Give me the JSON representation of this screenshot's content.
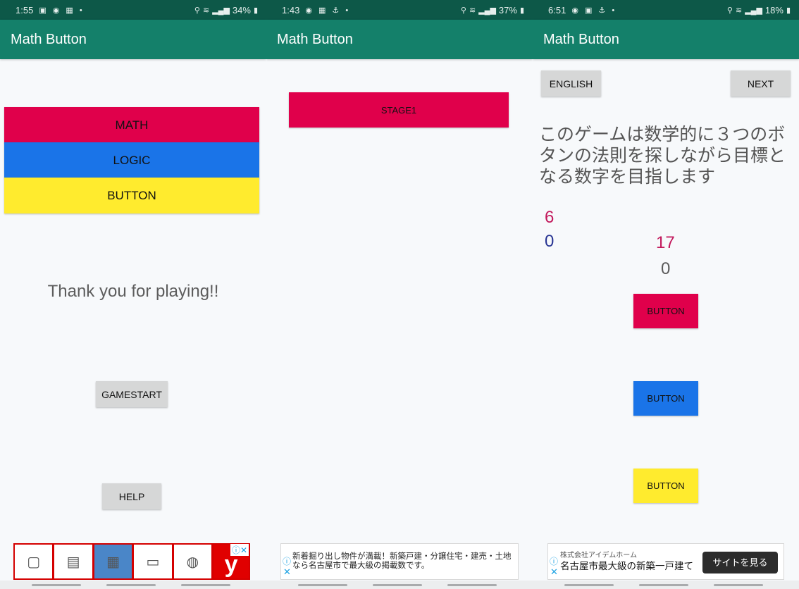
{
  "screens": [
    {
      "status": {
        "time": "1:55",
        "battery": "34%"
      },
      "app_title": "Math Button",
      "banner": [
        "MATH",
        "LOGIC",
        "BUTTON"
      ],
      "message": "Thank you for playing!!",
      "gamestart": "GAMESTART",
      "help": "HELP"
    },
    {
      "status": {
        "time": "1:43",
        "battery": "37%"
      },
      "app_title": "Math Button",
      "stage": "STAGE1",
      "ad_text": "新着掘り出し物件が満載！新築戸建・分譲住宅・建売・土地なら名古屋市で最大級の掲載数です。"
    },
    {
      "status": {
        "time": "6:51",
        "battery": "18%"
      },
      "app_title": "Math Button",
      "english": "ENGLISH",
      "next": "NEXT",
      "description": "このゲームは数学的に３つのボタンの法則を探しながら目標となる数字を目指します",
      "value_red": "6",
      "value_navy": "0",
      "target": "17",
      "current": "0",
      "button_red": "BUTTON",
      "button_blue": "BUTTON",
      "button_yellow": "BUTTON",
      "ad_company": "株式会社アイデムホーム",
      "ad_headline": "名古屋市最大級の新築一戸建て",
      "ad_cta": "サイトを見る"
    }
  ],
  "colors": {
    "status_bar": "#0d5848",
    "app_bar": "#14806a",
    "red": "#e0004b",
    "blue": "#1a74e8",
    "yellow": "#ffeb2e"
  }
}
